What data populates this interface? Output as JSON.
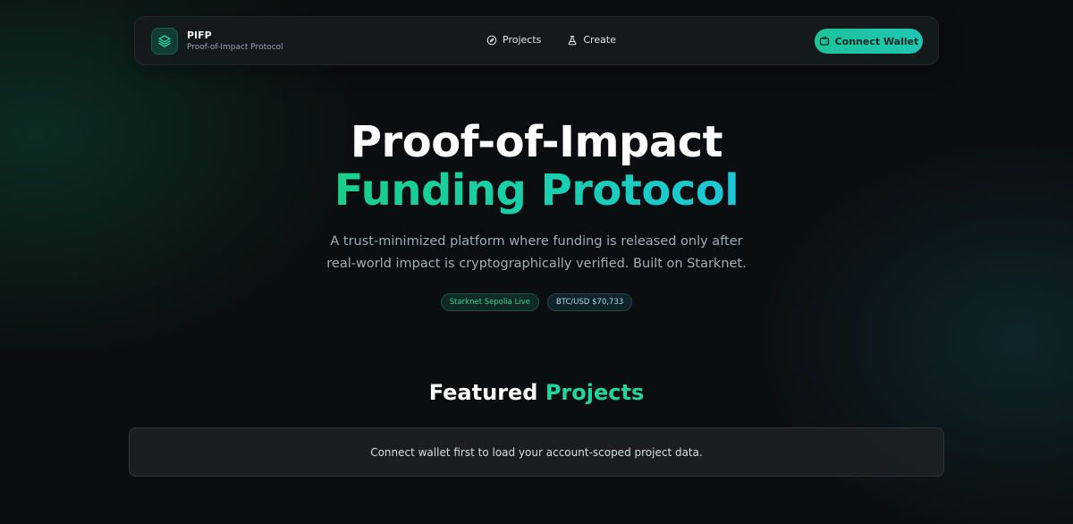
{
  "brand": {
    "name": "PIFP",
    "tagline": "Proof-of-Impact Protocol",
    "logo_icon": "layers-icon"
  },
  "nav": {
    "items": [
      {
        "label": "Projects",
        "icon": "compass-icon"
      },
      {
        "label": "Create",
        "icon": "flask-icon"
      }
    ],
    "connect_button": {
      "label": "Connect Wallet",
      "icon": "wallet-icon"
    }
  },
  "hero": {
    "title_line1": "Proof-of-Impact",
    "title_line2": "Funding Protocol",
    "subtitle": "A trust-minimized platform where funding is released only after real-world impact is cryptographically verified. Built on Starknet.",
    "badges": [
      {
        "label": "Starknet Sepolia Live"
      },
      {
        "label": "BTC/USD $70,733"
      }
    ]
  },
  "featured": {
    "title_part1": "Featured",
    "title_part2": "Projects",
    "notice": "Connect wallet first to load your account-scoped project data."
  },
  "colors": {
    "accent": "#1fd69b",
    "accent_end": "#1ec6d8",
    "background": "#0b0e10"
  }
}
